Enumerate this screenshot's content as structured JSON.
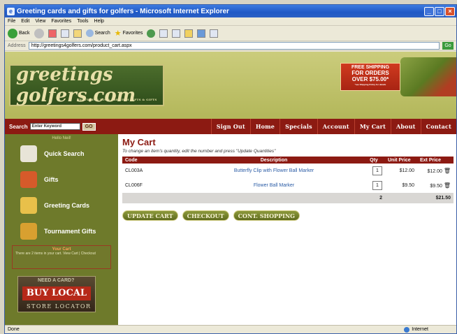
{
  "window": {
    "title": "Greeting cards and gifts for golfers - Microsoft Internet Explorer"
  },
  "menu": [
    "File",
    "Edit",
    "View",
    "Favorites",
    "Tools",
    "Help"
  ],
  "toolbar": {
    "back_label": "Back",
    "search_label": "Search",
    "favorites_label": "Favorites"
  },
  "address": {
    "label": "Address",
    "url": "http://greetings4golfers.com/product_cart.aspx",
    "go_label": "Go"
  },
  "site": {
    "logo_text": "greetings golfers.com",
    "tagline": "FEATURING YOUR PREMIUM GIFTS & GIFTS",
    "promo": {
      "line1": "FREE SHIPPING",
      "line2": "FOR ORDERS",
      "line3": "OVER $75.00*",
      "line4": "*see Shipping Policy for details"
    }
  },
  "search": {
    "label": "Search",
    "placeholder": "Enter Keyword",
    "go_label": "GO"
  },
  "nav": [
    "Sign Out",
    "Home",
    "Specials",
    "Account",
    "My Cart",
    "About",
    "Contact"
  ],
  "sidebar": {
    "greeting": "Hello Neil!",
    "items": [
      {
        "label": "Quick Search",
        "icon": "magnifier-icon"
      },
      {
        "label": "Gifts",
        "icon": "gift-icon"
      },
      {
        "label": "Greeting Cards",
        "icon": "envelope-icon"
      },
      {
        "label": "Tournament Gifts",
        "icon": "trophy-icon"
      }
    ],
    "cart_box": {
      "title": "Your Cart",
      "text": "There are 2 items in your cart. View Cart | Checkout"
    },
    "buy_local": {
      "line1": "NEED A CARD?",
      "line2": "BUY LOCAL",
      "line3": "STORE LOCATOR"
    }
  },
  "cart": {
    "title": "My Cart",
    "hint": "To change an item's quantity, edit the number and press \"Update Quantities\"",
    "columns": [
      "Code",
      "Description",
      "Qty",
      "Unit Price",
      "Ext Price"
    ],
    "rows": [
      {
        "code": "CL003A",
        "description": "Butterfly Clip with Flower Ball Marker",
        "qty": "1",
        "unit": "$12.00",
        "ext": "$12.00"
      },
      {
        "code": "CL006F",
        "description": "Flower Ball Marker",
        "qty": "1",
        "unit": "$9.50",
        "ext": "$9.50"
      }
    ],
    "total_qty": "2",
    "total_price": "$21.50",
    "buttons": {
      "update": "UPDATE CART",
      "checkout": "CHECKOUT",
      "continue": "CONT. SHOPPING"
    }
  },
  "status": {
    "left": "Done",
    "zone": "Internet"
  }
}
